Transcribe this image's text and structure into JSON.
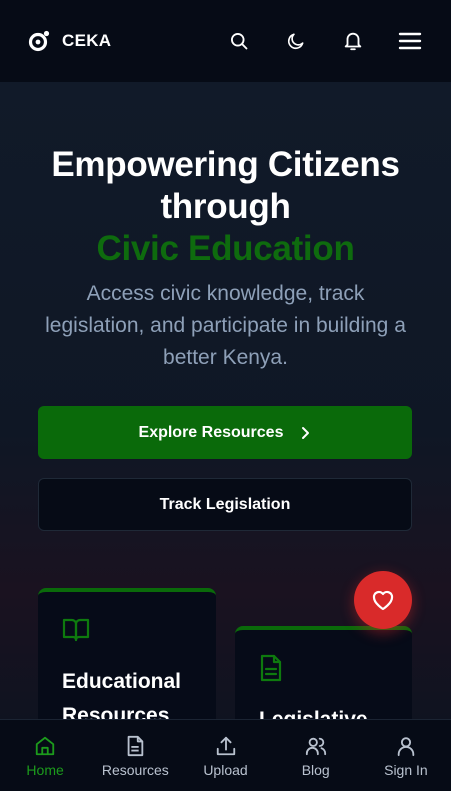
{
  "header": {
    "brand": "CEKA",
    "icons": [
      "search-icon",
      "moon-icon",
      "bell-icon",
      "menu-icon"
    ]
  },
  "hero": {
    "title_line1": "Empowering Citizens",
    "title_line2": "through",
    "title_highlight": "Civic Education",
    "subtitle": "Access civic knowledge, track legislation, and participate in building a better Kenya.",
    "primary_button": "Explore Resources",
    "secondary_button": "Track Legislation"
  },
  "cards": [
    {
      "title": "Educational Resources",
      "icon": "book-icon"
    },
    {
      "title": "Legislative",
      "icon": "document-icon"
    }
  ],
  "bottom_nav": [
    {
      "label": "Home",
      "icon": "home-icon"
    },
    {
      "label": "Resources",
      "icon": "document-icon"
    },
    {
      "label": "Upload",
      "icon": "upload-icon"
    },
    {
      "label": "Blog",
      "icon": "users-icon"
    },
    {
      "label": "Sign In",
      "icon": "user-icon"
    }
  ],
  "colors": {
    "accent_green": "#0a6a0a",
    "active_nav_green": "#1c9b1c",
    "fab_red": "#d92a2a",
    "background": "#0c1220"
  }
}
